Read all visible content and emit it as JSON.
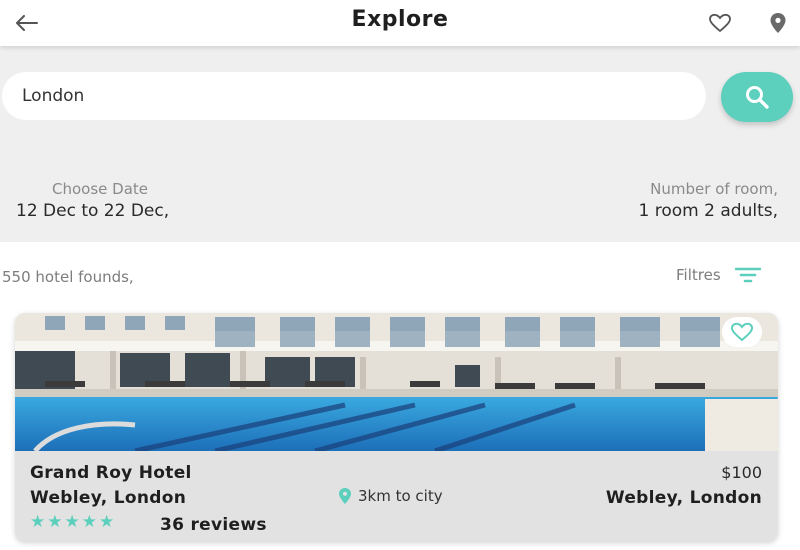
{
  "appbar": {
    "title": "Explore",
    "icons": [
      "back-arrow-icon",
      "heart-icon",
      "map-pin-icon"
    ]
  },
  "search": {
    "value": "London",
    "placeholder": "London",
    "button_icon": "search-icon"
  },
  "date": {
    "label": "Choose Date",
    "value": "12 Dec to 22 Dec,"
  },
  "rooms": {
    "label": "Number of room,",
    "value": "1 room 2 adults,"
  },
  "results": {
    "count_text": "550 hotel founds,",
    "filters_label": "Filtres",
    "filters_icon": "filter-icon"
  },
  "hotel": {
    "name": "Grand Roy Hotel",
    "price": "$100",
    "location": "Webley, London",
    "distance": "3km to city",
    "location_right": "Webley, London",
    "rating": 5,
    "reviews": "36 reviews"
  },
  "colors": {
    "accent": "#5ccfbd",
    "background_grey": "#efefef",
    "card_bg": "#e2e2e2",
    "text_dark": "#1f1f1f",
    "text_muted": "#8a8a8a"
  }
}
